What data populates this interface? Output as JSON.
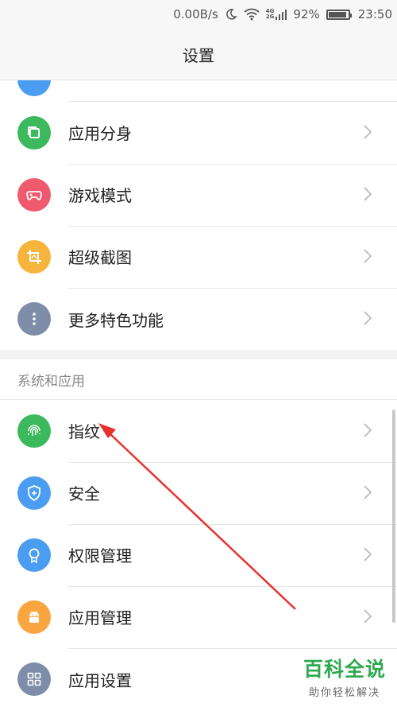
{
  "status_bar": {
    "speed": "0.00B/s",
    "network_top": "4G",
    "network_bottom": "2G",
    "battery": "92%",
    "battery_level": 0.92,
    "time": "23:50"
  },
  "header": {
    "title": "设置"
  },
  "group1": {
    "items": [
      {
        "label": "应用分身",
        "color": "#3cb95c",
        "icon": "copy-icon"
      },
      {
        "label": "游戏模式",
        "color": "#ef5a6e",
        "icon": "gamepad-icon"
      },
      {
        "label": "超级截图",
        "color": "#f6b43c",
        "icon": "crop-icon"
      },
      {
        "label": "更多特色功能",
        "color": "#7e8ea8",
        "icon": "more-dots-icon"
      }
    ]
  },
  "section2": {
    "title": "系统和应用",
    "items": [
      {
        "label": "指纹",
        "color": "#3cb95c",
        "icon": "fingerprint-icon"
      },
      {
        "label": "安全",
        "color": "#4a9df0",
        "icon": "shield-icon"
      },
      {
        "label": "权限管理",
        "color": "#4a9df0",
        "icon": "badge-icon"
      },
      {
        "label": "应用管理",
        "color": "#f9a640",
        "icon": "android-icon"
      },
      {
        "label": "应用设置",
        "color": "#7e8ea8",
        "icon": "grid-icon"
      }
    ]
  },
  "watermark": {
    "title": "百科全说",
    "subtitle": "助你轻松解决"
  },
  "annotation": {
    "color": "#e8312c"
  }
}
